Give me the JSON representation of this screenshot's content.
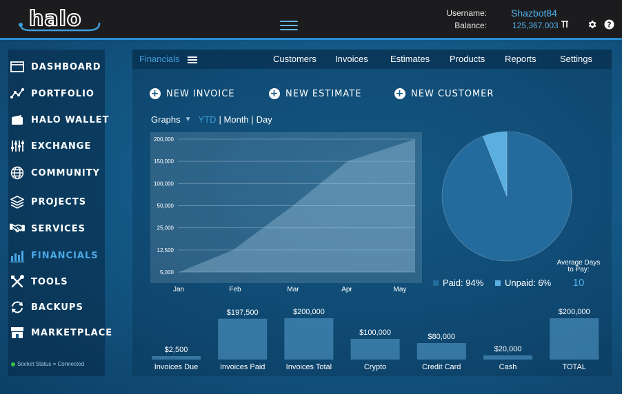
{
  "header": {
    "logo_text": "halo",
    "username_label": "Username:",
    "username": "Shazbot84",
    "balance_label": "Balance:",
    "balance": "125,367.003"
  },
  "sidebar": {
    "items": [
      {
        "label": "DASHBOARD",
        "icon": "dashboard-icon"
      },
      {
        "label": "PORTFOLIO",
        "icon": "portfolio-icon"
      },
      {
        "label": "HALO WALLET",
        "icon": "wallet-icon"
      },
      {
        "label": "EXCHANGE",
        "icon": "exchange-icon"
      },
      {
        "label": "COMMUNITY",
        "icon": "globe-icon"
      },
      {
        "label": "PROJECTS",
        "icon": "layers-icon"
      },
      {
        "label": "SERVICES",
        "icon": "handshake-icon"
      },
      {
        "label": "FINANCIALS",
        "icon": "bar-chart-icon",
        "active": true
      },
      {
        "label": "TOOLS",
        "icon": "tools-icon"
      },
      {
        "label": "BACKUPS",
        "icon": "refresh-icon"
      },
      {
        "label": "MARKETPLACE",
        "icon": "store-icon"
      }
    ],
    "socket_status": "Socket Status = Connected"
  },
  "tabs": {
    "current": "Financials",
    "items": [
      "Customers",
      "Invoices",
      "Estimates",
      "Products",
      "Reports",
      "Settings"
    ]
  },
  "actions": {
    "new_invoice": "NEW INVOICE",
    "new_estimate": "NEW ESTIMATE",
    "new_customer": "NEW CUSTOMER"
  },
  "graph_controls": {
    "label": "Graphs",
    "ytd": "YTD",
    "month": "| Month |",
    "day": "Day"
  },
  "chart_data": [
    {
      "type": "area",
      "categories": [
        "Jan",
        "Feb",
        "Mar",
        "Apr",
        "May"
      ],
      "y_ticks": [
        "5,000",
        "12,500",
        "25,000",
        "50,000",
        "100,000",
        "150,000",
        "200,000"
      ],
      "values": [
        5000,
        12500,
        50000,
        150000,
        200000
      ],
      "grid": true
    },
    {
      "type": "pie",
      "slices": [
        {
          "name": "Paid: 94%",
          "value": 94,
          "color": "#236b9c"
        },
        {
          "name": "Unpaid: 6%",
          "value": 6,
          "color": "#5aaee0"
        }
      ],
      "legend": "bottom"
    },
    {
      "type": "bar",
      "categories": [
        "Invoices Due",
        "Invoices Paid",
        "Invoices Total",
        "Crypto",
        "Credit Card",
        "Cash",
        "TOTAL"
      ],
      "values": [
        2500,
        197500,
        200000,
        100000,
        80000,
        20000,
        200000
      ],
      "value_labels": [
        "$2,500",
        "$197,500",
        "$200,000",
        "$100,000",
        "$80,000",
        "$20,000",
        "$200,000"
      ]
    }
  ],
  "avg_days": {
    "label_line1": "Average Days",
    "label_line2": "to Pay:",
    "value": "10"
  },
  "colors": {
    "accent": "#3f9fdc",
    "topbar": "#1c1c1e",
    "paid": "#236b9c",
    "unpaid": "#5aaee0"
  }
}
